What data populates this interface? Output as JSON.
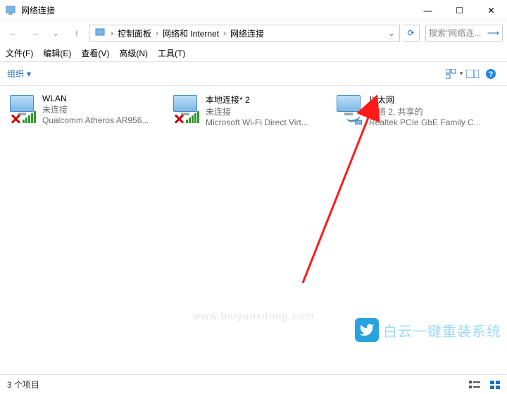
{
  "window": {
    "title": "网络连接",
    "min": "—",
    "max": "☐",
    "close": "✕"
  },
  "nav": {
    "back": "←",
    "forward": "→",
    "recent": "⌄",
    "up": "↑",
    "refresh": "⟳",
    "dropdown": "⌄"
  },
  "breadcrumb": {
    "seg1": "控制面板",
    "seg2": "网络和 Internet",
    "seg3": "网络连接"
  },
  "search": {
    "placeholder": "搜索\"网络连..."
  },
  "menu": {
    "file": "文件(F)",
    "edit": "编辑(E)",
    "view": "查看(V)",
    "advanced": "高级(N)",
    "tools": "工具(T)"
  },
  "toolbar": {
    "organize": "组织",
    "help": "?"
  },
  "connections": [
    {
      "name": "WLAN",
      "status": "未连接",
      "device": "Qualcomm Atheros AR956...",
      "disabled": true,
      "hasBars": true
    },
    {
      "name": "本地连接* 2",
      "status": "未连接",
      "device": "Microsoft Wi-Fi Direct Virt...",
      "disabled": true,
      "hasBars": true
    },
    {
      "name": "以太网",
      "status": "网络 2, 共享的",
      "device": "Realtek PCIe GbE Family C...",
      "disabled": false,
      "hasBars": false
    }
  ],
  "statusbar": {
    "count": "3 个项目"
  },
  "brand": {
    "text": "白云一键重装系统"
  },
  "watermark": "www.baiyunxitong.com"
}
